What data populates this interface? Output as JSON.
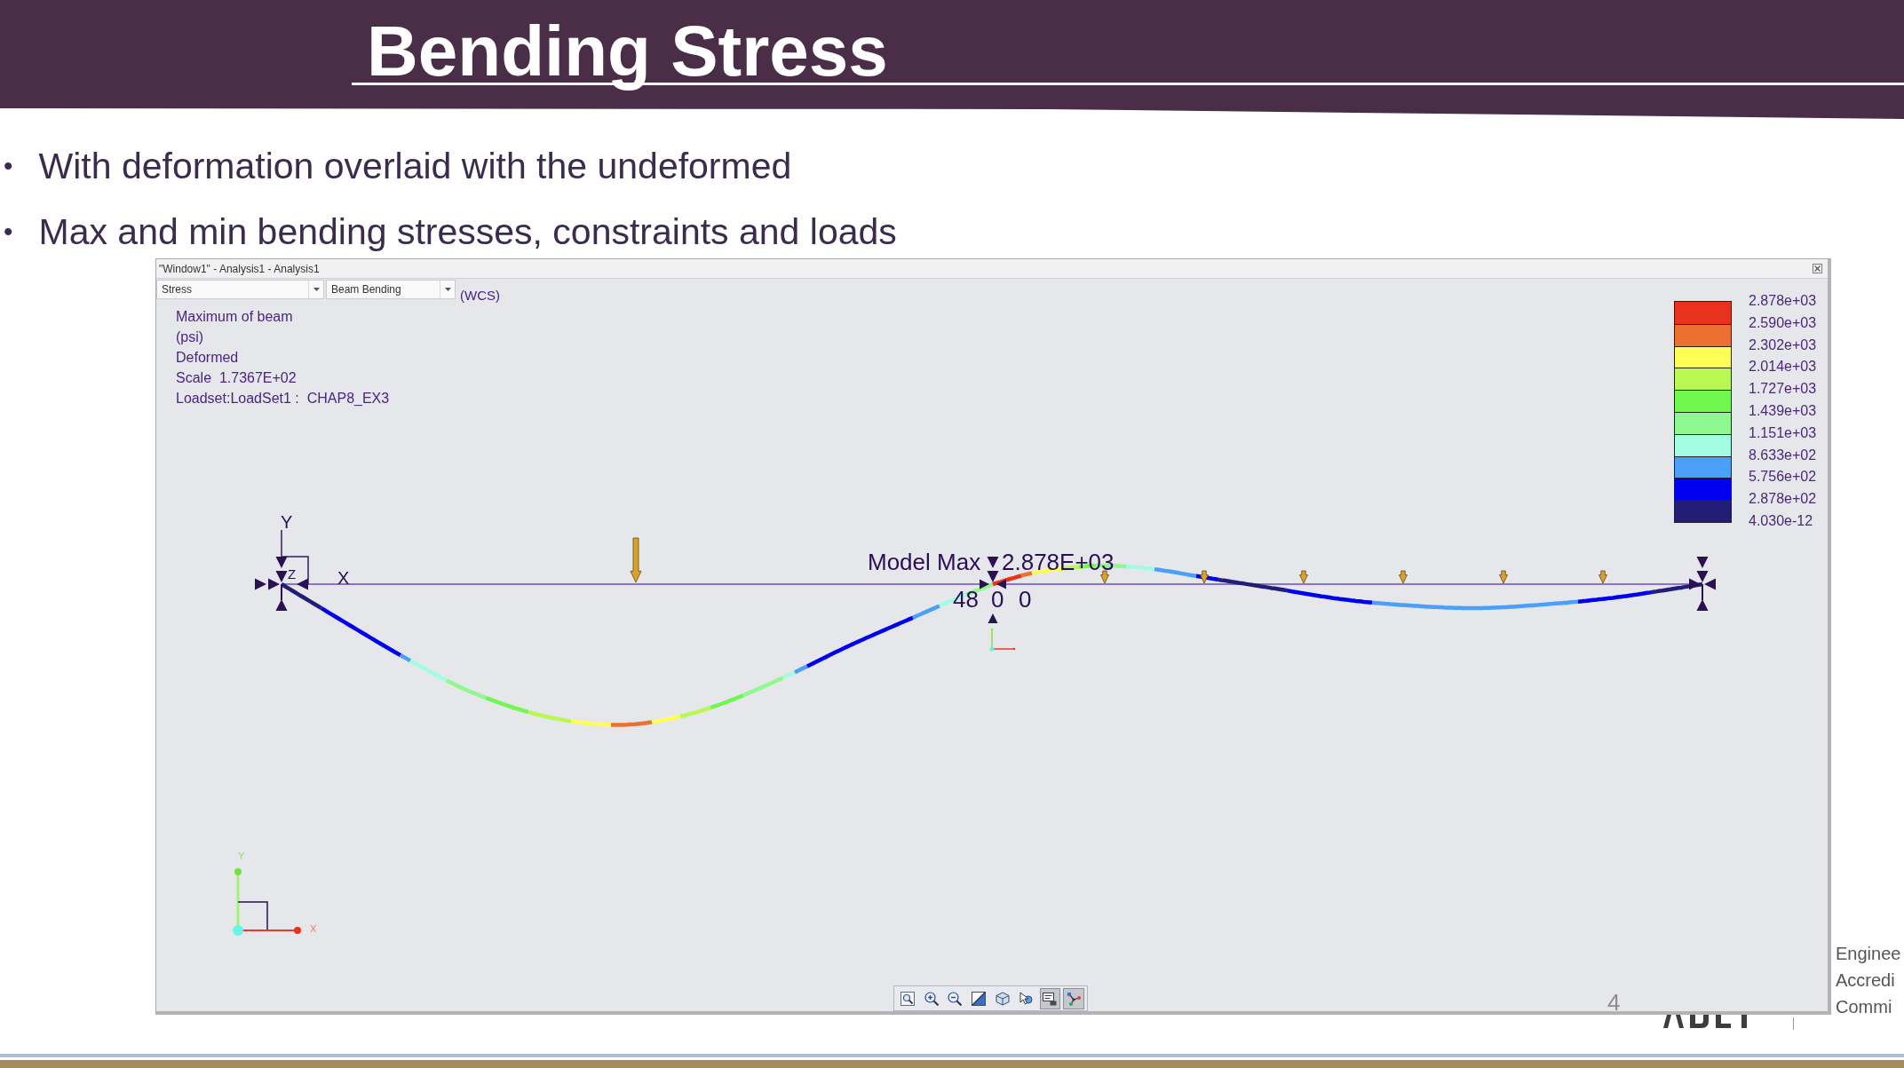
{
  "slide": {
    "title": "Bending Stress",
    "bullets": [
      {
        "marker": "•",
        "text": "With deformation overlaid with the undeformed"
      },
      {
        "marker": "•",
        "text": "Max and min bending stresses, constraints and loads"
      }
    ],
    "page_number": "4",
    "logo_text_lines": [
      "Enginee",
      "Accredi",
      "Commi"
    ]
  },
  "window": {
    "title": "\"Window1\" - Analysis1 - Analysis1",
    "dropdowns": [
      {
        "value": "Stress"
      },
      {
        "value": "Beam Bending"
      }
    ],
    "coordinate_system": "(WCS)",
    "info_lines": [
      "Maximum of beam",
      "(psi)",
      "Deformed",
      "Scale  1.7367E+02",
      "Loadset:LoadSet1 :  CHAP8_EX3"
    ],
    "legend": {
      "bands": [
        {
          "color": "#e8321e"
        },
        {
          "color": "#ec7030"
        },
        {
          "color": "#ffff55"
        },
        {
          "color": "#b8f850"
        },
        {
          "color": "#70f850"
        },
        {
          "color": "#90f890"
        },
        {
          "color": "#a2fce2"
        },
        {
          "color": "#4aa0f8"
        },
        {
          "color": "#0000f0"
        },
        {
          "color": "#221e78"
        }
      ],
      "labels": [
        "2.878e+03",
        "2.590e+03",
        "2.302e+03",
        "2.014e+03",
        "1.727e+03",
        "1.439e+03",
        "1.151e+03",
        "8.633e+02",
        "5.756e+02",
        "2.878e+02",
        "4.030e-12"
      ]
    },
    "plot": {
      "axis_labels": {
        "y": "Y",
        "x": "X",
        "z": "Z"
      },
      "max_label": "Model Max",
      "max_value": "2.878E+03",
      "node_coords": [
        "48",
        "0",
        "0"
      ],
      "triad_labels": {
        "y": "Y",
        "x": "X"
      }
    },
    "toolbar": [
      {
        "active": false
      },
      {
        "active": false
      },
      {
        "active": false
      },
      {
        "active": false
      },
      {
        "active": false
      },
      {
        "active": false
      },
      {
        "active": true
      },
      {
        "active": true
      }
    ]
  }
}
